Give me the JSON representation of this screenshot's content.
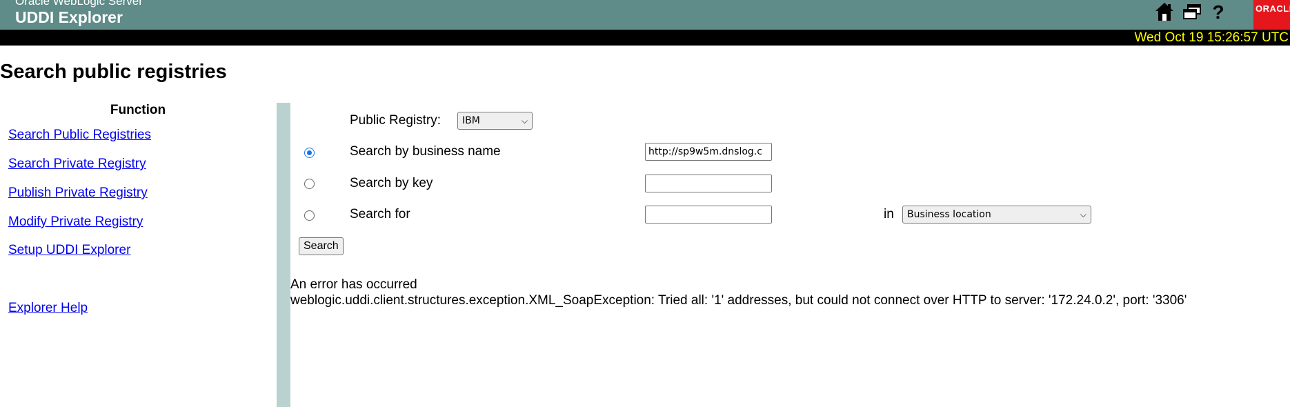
{
  "header": {
    "product": "Oracle WebLogic Server",
    "title": "UDDI Explorer",
    "brand": "ORACLE",
    "icons": [
      "home-icon",
      "windows-icon",
      "help-icon"
    ],
    "datetime": "Wed Oct 19 15:26:57 UTC"
  },
  "page": {
    "title": "Search public registries"
  },
  "nav": {
    "heading": "Function",
    "items": [
      "Search Public Registries",
      "Search Private Registry",
      "Publish Private Registry",
      "Modify Private Registry",
      "Setup UDDI Explorer"
    ],
    "help": "Explorer Help"
  },
  "form": {
    "registry_label": "Public Registry:",
    "registry_value": "IBM",
    "business_label": "Search by business name",
    "business_value": "http://sp9w5m.dnslog.c",
    "key_label": "Search by key",
    "key_value": "",
    "for_label": "Search for",
    "for_value": "",
    "in_label": "in",
    "in_value": "Business location",
    "selected_option": "Search by business name",
    "search_button": "Search"
  },
  "error": {
    "line1": "An error has occurred",
    "line2": "weblogic.uddi.client.structures.exception.XML_SoapException: Tried all: '1' addresses, but could not connect over HTTP to server: '172.24.0.2', port: '3306'"
  },
  "colors": {
    "header_bg": "#5f8b88",
    "divider": "#b9d2cf",
    "date_text": "#ffff00",
    "brand_bg": "#e5171d",
    "link": "#0000ee"
  }
}
